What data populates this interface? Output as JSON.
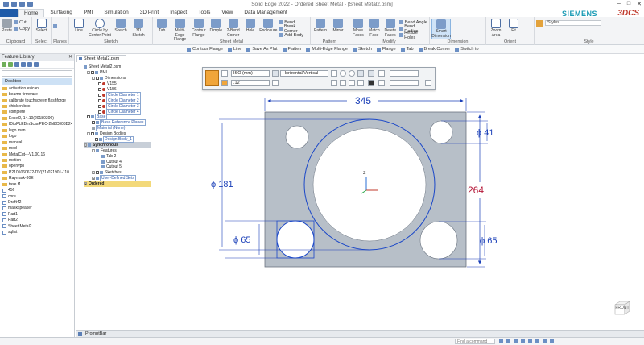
{
  "window": {
    "title": "Solid Edge 2022 - Ordered Sheet Metal - [Sheet Metal2.psm]",
    "controls": [
      "–",
      "□",
      "✕"
    ]
  },
  "menu": {
    "tabs": [
      "Home",
      "Surfacing",
      "PMI",
      "Simulation",
      "3D Print",
      "Inspect",
      "Tools",
      "View",
      "Data Management"
    ],
    "active": "Home",
    "brand": "SIEMENS",
    "logo": "3DCS"
  },
  "ribbon": {
    "groups": [
      {
        "label": "Clipboard",
        "buttons": [
          "Paste"
        ],
        "small": [
          "Cut",
          "Copy"
        ]
      },
      {
        "label": "Select",
        "buttons": [
          "Select"
        ]
      },
      {
        "label": "Planes",
        "small": [
          "Planes"
        ]
      },
      {
        "label": "Sketch",
        "buttons": [
          "Line",
          "Circle by Center Point",
          "Sketch",
          "3D Sketch"
        ]
      },
      {
        "label": "Sheet Metal",
        "buttons": [
          "Tab",
          "Multi-Edge Flange",
          "Contour Flange",
          "Dimple",
          "2-Bend Corner",
          "Hole",
          "Enclosure"
        ],
        "small": [
          "Bend",
          "Break Corner",
          "Add Body"
        ]
      },
      {
        "label": "Pattern",
        "buttons": [
          "Pattern",
          "Mirror"
        ]
      },
      {
        "label": "Modify",
        "buttons": [
          "Move Faces",
          "Match Face",
          "Delete Faces"
        ],
        "small": [
          "Bend Angle",
          "Bend Radius",
          "Resize Holes"
        ]
      },
      {
        "label": "Dimension",
        "buttons": [
          "Smart Dimension"
        ]
      },
      {
        "label": "Orient",
        "buttons": [
          "Zoom Area",
          "Fit"
        ]
      },
      {
        "label": "Style",
        "buttons": [],
        "styles_label": "Styles"
      }
    ]
  },
  "command_bar": {
    "items": [
      "Contour Flange",
      "Line",
      "Save As Plat",
      "Flatten",
      "Multi-Edge Flange",
      "Sketch",
      "Flange",
      "Tab",
      "Break Corner",
      "Switch to"
    ]
  },
  "feature_library": {
    "title": "Feature Library",
    "location": "Desktop",
    "items": [
      "activation.esican",
      "beamo firmware",
      "calibrate touchscreen flashforge",
      "chicken box",
      "complete",
      "Excel2, 14.10(20180306)",
      "IDtoPLEB nScanPEC-2N8C003B24",
      "lego man",
      "logo",
      "manual",
      "med",
      "MetalCut---V1.00.16",
      "motion",
      "openvpn",
      "P2105060672-DV(21)021901-110",
      "Raymark-30E",
      "tase f1",
      "456",
      "core",
      "Draft42",
      "maskspeaker",
      "Part1",
      "Part2",
      "Sheet Metal2",
      "sqlist"
    ]
  },
  "document_tab": {
    "label": "Sheet Metal2.psm"
  },
  "pathfinder": {
    "root": "Sheet Metal2.psm",
    "pmi": "PMI",
    "dimensions_label": "Dimensions",
    "dimensions": [
      "V155",
      "V156",
      "Circle Diameter 1",
      "Circle Diameter 2",
      "Circle Diameter 3",
      "Circle Diameter 4"
    ],
    "base": "Base",
    "base_planes": "Base Reference Planes",
    "material": "Material (None)",
    "design_bodies": "Design Bodies",
    "design_body": "Design Body_1",
    "synchronous": "Synchronous",
    "features": "Features",
    "feature_items": [
      "Tab 2",
      "Cutout 4",
      "Cutout 5"
    ],
    "sketches": "Sketches",
    "user_sets": "User-Defined Sets",
    "ordered": "Ordered"
  },
  "dimension_bar": {
    "standard": "ISO (mm)",
    "orientation": "Horizontal/Vertical",
    "precision": ".12"
  },
  "drawing": {
    "dimensions": {
      "width": "345",
      "height": "264",
      "big_circle": "ϕ 181",
      "small_top_right": "ϕ 41",
      "bottom_left": "ϕ 65",
      "bottom_right": "ϕ 65"
    },
    "axis_label": "z"
  },
  "view": {
    "cube_label": "FRONT"
  },
  "prompt_bar": {
    "label": "PromptBar"
  },
  "status_bar": {
    "find_placeholder": "Find a command"
  },
  "colors": {
    "plate": "#b7bfc8",
    "dimension": "#1a3fb8",
    "sketch": "#1a47c8",
    "app_accent": "#1f5ba8",
    "brand": "#1a9bb5"
  }
}
